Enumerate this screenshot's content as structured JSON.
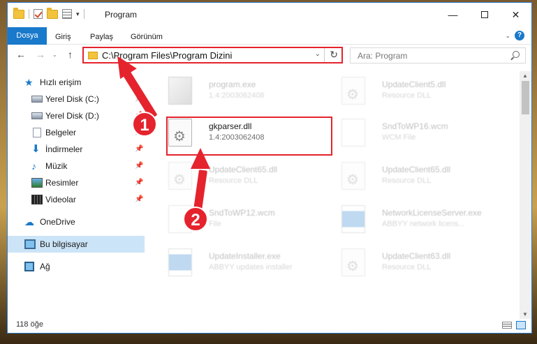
{
  "window": {
    "title": "Program"
  },
  "quick_access_toolbar": {
    "icons": [
      "folder-icon",
      "properties-check-icon",
      "new-folder-icon",
      "properties-icon",
      "customize-arrow-icon"
    ]
  },
  "controls": {
    "minimize": "—",
    "close": "✕"
  },
  "ribbon": {
    "tabs": [
      "Dosya",
      "Giriş",
      "Paylaş",
      "Görünüm"
    ],
    "collapse": "⌄",
    "help": "?"
  },
  "nav": {
    "back": "←",
    "forward": "→",
    "recent": "⌄",
    "up": "↑",
    "address": "C:\\Program Files\\Program Dizini",
    "address_dropdown": "⌄",
    "refresh": "↻",
    "search_placeholder": "Ara: Program"
  },
  "sidebar": {
    "items": [
      {
        "label": "Hızlı erişim",
        "icon": "star-icon",
        "pinned": false
      },
      {
        "label": "Yerel Disk (C:)",
        "icon": "disk-icon",
        "pinned": true
      },
      {
        "label": "Yerel Disk (D:)",
        "icon": "disk-icon",
        "pinned": true
      },
      {
        "label": "Belgeler",
        "icon": "documents-icon",
        "pinned": true
      },
      {
        "label": "İndirmeler",
        "icon": "downloads-icon",
        "pinned": true
      },
      {
        "label": "Müzik",
        "icon": "music-icon",
        "pinned": true
      },
      {
        "label": "Resimler",
        "icon": "pictures-icon",
        "pinned": true
      },
      {
        "label": "Videolar",
        "icon": "videos-icon",
        "pinned": true
      },
      {
        "label": "OneDrive",
        "icon": "cloud-icon",
        "pinned": false
      },
      {
        "label": "Bu bilgisayar",
        "icon": "computer-icon",
        "pinned": false
      },
      {
        "label": "Ağ",
        "icon": "network-icon",
        "pinned": false
      }
    ],
    "pin_glyph": "📌"
  },
  "files": [
    {
      "name": "program.exe",
      "sub": "1.4:2003062408",
      "faded": true
    },
    {
      "name": "UpdateClient5.dll",
      "sub": "Resource DLL",
      "faded": true
    },
    {
      "name": "gkparser.dll",
      "sub": "1.4:2003062408",
      "faded": false
    },
    {
      "name": "SndToWP16.wcm",
      "sub": "WCM File",
      "faded": true
    },
    {
      "name": "UpdateClient65.dll",
      "sub": "Resource DLL",
      "faded": true
    },
    {
      "name": "UpdateClient65.dll",
      "sub": "Resource DLL",
      "faded": true
    },
    {
      "name": "SndToWP12.wcm",
      "sub": "File",
      "faded": true
    },
    {
      "name": "NetworkLicenseServer.exe",
      "sub": "ABBYY network licens...",
      "faded": true
    },
    {
      "name": "UpdateInstaller.exe",
      "sub": "ABBYY updates installer",
      "faded": true
    },
    {
      "name": "UpdateClient63.dll",
      "sub": "Resource DLL",
      "faded": true
    }
  ],
  "scroll": {
    "up": "▲",
    "down": "▼"
  },
  "status": {
    "item_count": "118 öğe"
  },
  "annotations": {
    "step1": "1",
    "step2": "2"
  },
  "colors": {
    "accent": "#1979ca",
    "annotation": "#e5232d",
    "selected": "#cce4f7"
  }
}
